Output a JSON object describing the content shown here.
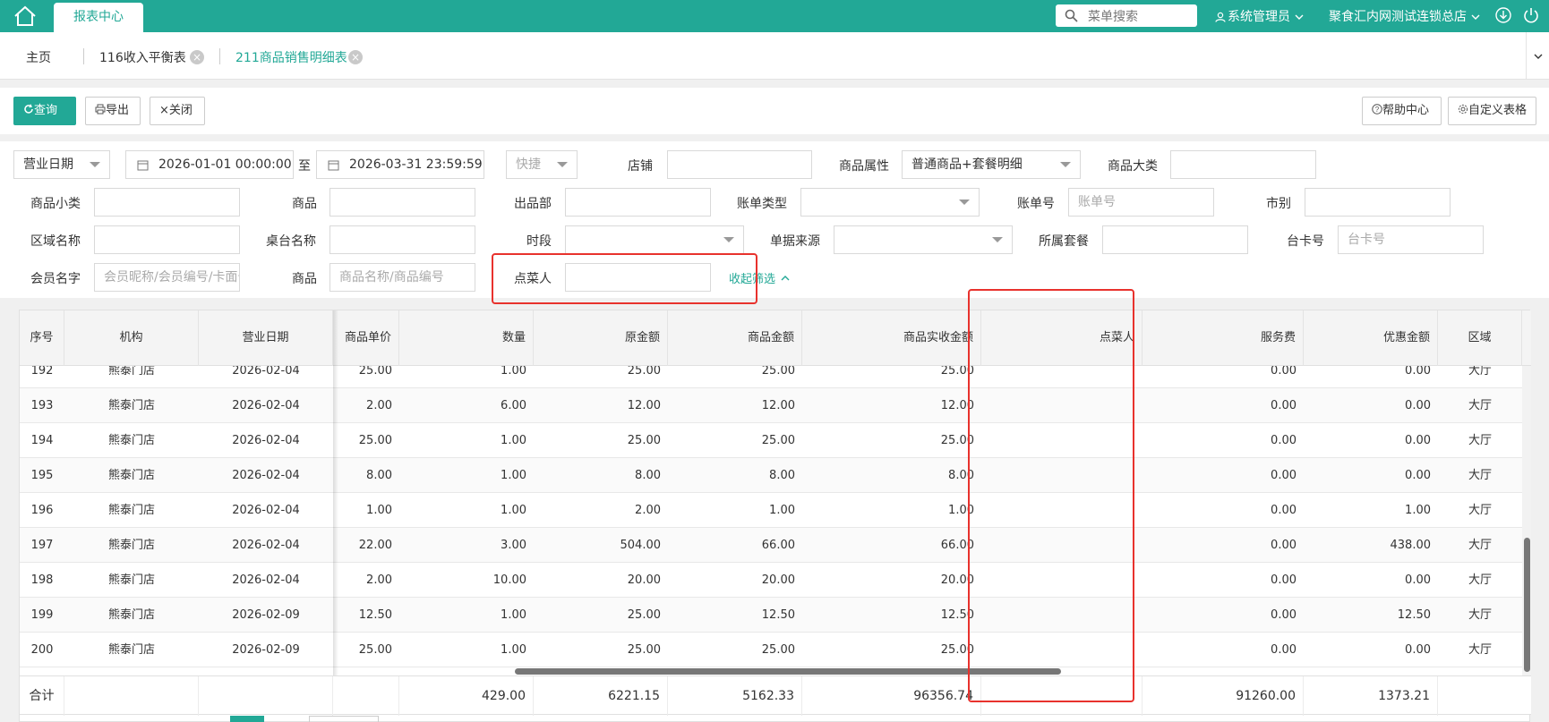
{
  "topbar": {
    "active_tab": "报表中心",
    "search_placeholder": "菜单搜索",
    "user": "系统管理员",
    "org": "聚食汇内网测试连锁总店"
  },
  "tabs": [
    {
      "label": "主页"
    },
    {
      "label": "116收入平衡表",
      "close": "×"
    },
    {
      "label": "211商品销售明细表",
      "close": "×"
    }
  ],
  "toolbar": {
    "query": "查询",
    "export": "导出",
    "close": "关闭",
    "help": "帮助中心",
    "custom": "自定义表格"
  },
  "filters": {
    "date_type": "营业日期",
    "start": "2026-01-01 00:00:00",
    "to": "至",
    "end": "2026-03-31 23:59:59",
    "quick": "快捷",
    "store": "店铺",
    "goods_attr_label": "商品属性",
    "goods_attr_value": "普通商品+套餐明细",
    "big_cat": "商品大类",
    "small_cat": "商品小类",
    "goods": "商品",
    "dept": "出品部",
    "bill_type": "账单类型",
    "bill_no": "账单号",
    "bill_no_ph": "账单号",
    "market": "市别",
    "area": "区域名称",
    "table_name": "桌台名称",
    "period": "时段",
    "source": "单据来源",
    "package": "所属套餐",
    "card_no": "台卡号",
    "card_no_ph": "台卡号",
    "member": "会员名字",
    "member_ph": "会员昵称/会员编号/卡面号",
    "goods2": "商品",
    "goods2_ph": "商品名称/商品编号",
    "orderer": "点菜人",
    "collapse": "收起筛选"
  },
  "table": {
    "headers": [
      "序号",
      "机构",
      "营业日期",
      "商品单价",
      "数量",
      "原金额",
      "商品金额",
      "商品实收金额",
      "点菜人",
      "服务费",
      "优惠金额",
      "区域"
    ],
    "rows": [
      [
        "192",
        "熊泰门店",
        "2026-02-04",
        "25.00",
        "1.00",
        "25.00",
        "25.00",
        "25.00",
        "",
        "0.00",
        "0.00",
        "大厅"
      ],
      [
        "193",
        "熊泰门店",
        "2026-02-04",
        "2.00",
        "6.00",
        "12.00",
        "12.00",
        "12.00",
        "",
        "0.00",
        "0.00",
        "大厅"
      ],
      [
        "194",
        "熊泰门店",
        "2026-02-04",
        "25.00",
        "1.00",
        "25.00",
        "25.00",
        "25.00",
        "",
        "0.00",
        "0.00",
        "大厅"
      ],
      [
        "195",
        "熊泰门店",
        "2026-02-04",
        "8.00",
        "1.00",
        "8.00",
        "8.00",
        "8.00",
        "",
        "0.00",
        "0.00",
        "大厅"
      ],
      [
        "196",
        "熊泰门店",
        "2026-02-04",
        "1.00",
        "1.00",
        "2.00",
        "1.00",
        "1.00",
        "",
        "0.00",
        "1.00",
        "大厅"
      ],
      [
        "197",
        "熊泰门店",
        "2026-02-04",
        "22.00",
        "3.00",
        "504.00",
        "66.00",
        "66.00",
        "",
        "0.00",
        "438.00",
        "大厅"
      ],
      [
        "198",
        "熊泰门店",
        "2026-02-04",
        "2.00",
        "10.00",
        "20.00",
        "20.00",
        "20.00",
        "",
        "0.00",
        "0.00",
        "大厅"
      ],
      [
        "199",
        "熊泰门店",
        "2026-02-09",
        "12.50",
        "1.00",
        "25.00",
        "12.50",
        "12.50",
        "",
        "0.00",
        "12.50",
        "大厅"
      ],
      [
        "200",
        "熊泰门店",
        "2026-02-09",
        "25.00",
        "1.00",
        "25.00",
        "25.00",
        "25.00",
        "",
        "0.00",
        "0.00",
        "大厅"
      ]
    ],
    "total": {
      "label": "合计",
      "qty": "429.00",
      "orig": "6221.15",
      "amount": "5162.33",
      "paid": "96356.74",
      "service": "91260.00",
      "discount": "1373.21"
    }
  }
}
